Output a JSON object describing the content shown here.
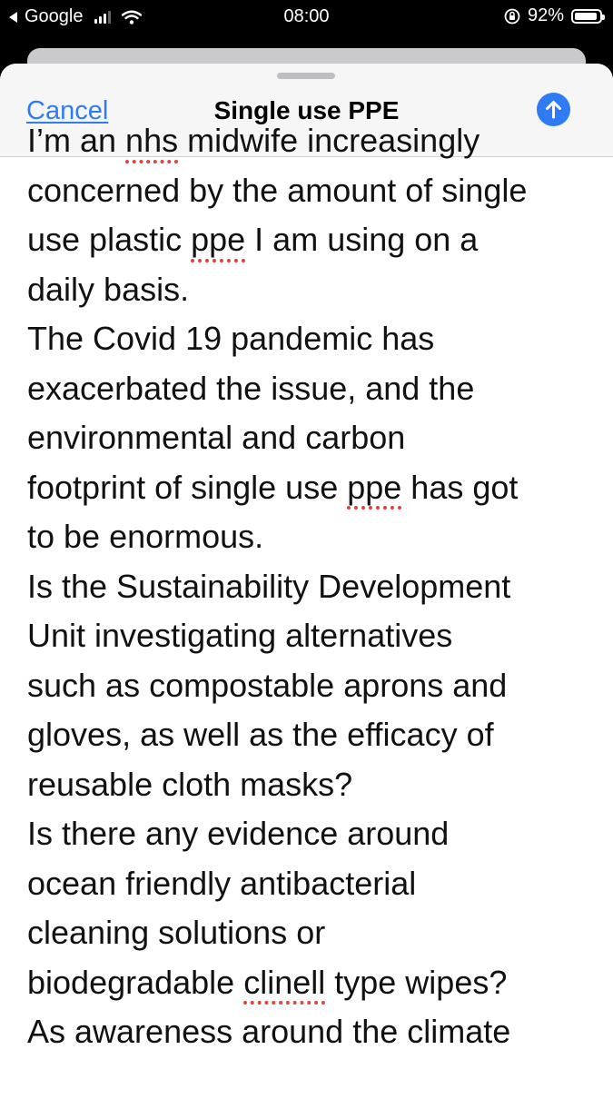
{
  "status_bar": {
    "back_app": "Google",
    "time": "08:00",
    "battery_text": "92%",
    "battery_level": 0.92
  },
  "header": {
    "cancel_label": "Cancel",
    "title": "Single use PPE"
  },
  "body": {
    "lines": [
      [
        {
          "t": "I’m an "
        },
        {
          "t": "nhs",
          "spell": true
        },
        {
          "t": " midwife increasingly"
        }
      ],
      [
        {
          "t": "concerned by the amount of single"
        }
      ],
      [
        {
          "t": "use plastic "
        },
        {
          "t": "ppe",
          "spell": true
        },
        {
          "t": " I am using on a"
        }
      ],
      [
        {
          "t": "daily basis."
        }
      ],
      [
        {
          "t": "The Covid 19 pandemic has"
        }
      ],
      [
        {
          "t": "exacerbated the issue, and the"
        }
      ],
      [
        {
          "t": "environmental and carbon"
        }
      ],
      [
        {
          "t": "footprint of single use "
        },
        {
          "t": "ppe",
          "spell": true
        },
        {
          "t": " has got"
        }
      ],
      [
        {
          "t": "to be enormous."
        }
      ],
      [
        {
          "t": "Is the Sustainability Development"
        }
      ],
      [
        {
          "t": "Unit investigating alternatives"
        }
      ],
      [
        {
          "t": "such as compostable aprons and"
        }
      ],
      [
        {
          "t": "gloves, as well as the efficacy of"
        }
      ],
      [
        {
          "t": "reusable cloth masks?"
        }
      ],
      [
        {
          "t": "Is there any evidence around"
        }
      ],
      [
        {
          "t": "ocean friendly antibacterial"
        }
      ],
      [
        {
          "t": "cleaning solutions or"
        }
      ],
      [
        {
          "t": "biodegradable "
        },
        {
          "t": "clinell",
          "spell": true
        },
        {
          "t": " type wipes?"
        }
      ],
      [
        {
          "t": "As awareness around the climate"
        }
      ]
    ]
  },
  "colors": {
    "accent": "#2f7bf6",
    "spellcheck": "#e2433b"
  }
}
